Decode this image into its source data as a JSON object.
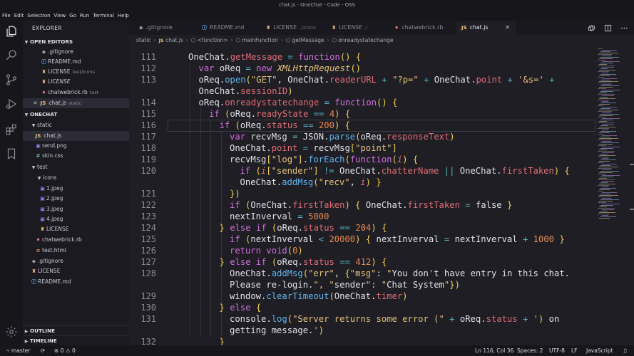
{
  "window": {
    "title": "chat.js - OneChat - Code - OSS"
  },
  "menu": [
    "File",
    "Edit",
    "Selection",
    "View",
    "Go",
    "Run",
    "Terminal",
    "Help"
  ],
  "activity": {
    "icons": [
      "files-icon",
      "search-icon",
      "source-control-icon",
      "run-debug-icon",
      "extensions-icon",
      "bookmark-icon",
      "gear-icon"
    ]
  },
  "sidebar": {
    "title": "EXPLORER",
    "open_editors": {
      "label": "OPEN EDITORS",
      "items": [
        {
          "name": ".gitignore",
          "desc": "",
          "icon": "git"
        },
        {
          "name": "README.md",
          "desc": "",
          "icon": "md"
        },
        {
          "name": "LICENSE",
          "desc": "test/icons",
          "icon": "lic"
        },
        {
          "name": "LICENSE",
          "desc": "",
          "icon": "lic",
          "italic": true
        },
        {
          "name": "chatwebrick.rb",
          "desc": "test",
          "icon": "rb"
        },
        {
          "name": "chat.js",
          "desc": "static",
          "icon": "js",
          "active": true
        }
      ]
    },
    "project": {
      "label": "ONECHAT",
      "items": [
        {
          "name": "static",
          "type": "folder",
          "depth": 1,
          "open": true
        },
        {
          "name": "chat.js",
          "icon": "js",
          "depth": 2,
          "selected": true
        },
        {
          "name": "send.png",
          "icon": "img",
          "depth": 2
        },
        {
          "name": "skin.css",
          "icon": "css",
          "depth": 2
        },
        {
          "name": "test",
          "type": "folder",
          "depth": 1,
          "open": true
        },
        {
          "name": "icons",
          "type": "folder",
          "depth": 2,
          "open": true
        },
        {
          "name": "1.jpeg",
          "icon": "img",
          "depth": 3
        },
        {
          "name": "2.jpeg",
          "icon": "img",
          "depth": 3
        },
        {
          "name": "3.jpeg",
          "icon": "img",
          "depth": 3
        },
        {
          "name": "4.jpeg",
          "icon": "img",
          "depth": 3
        },
        {
          "name": "LICENSE",
          "icon": "lic",
          "depth": 3
        },
        {
          "name": "chatwebrick.rb",
          "icon": "rb",
          "depth": 2
        },
        {
          "name": "test.html",
          "icon": "html",
          "depth": 2
        },
        {
          "name": ".gitignore",
          "icon": "git",
          "depth": 1
        },
        {
          "name": "LICENSE",
          "icon": "lic",
          "depth": 1
        },
        {
          "name": "README.md",
          "icon": "md",
          "depth": 1
        }
      ]
    },
    "outline": "OUTLINE",
    "timeline": "TIMELINE"
  },
  "tabs": [
    {
      "label": ".gitignore",
      "desc": "",
      "icon": "git"
    },
    {
      "label": "README.md",
      "desc": "",
      "icon": "md"
    },
    {
      "label": "LICENSE",
      "desc": "../icons",
      "icon": "lic"
    },
    {
      "label": "LICENSE",
      "desc": "./",
      "icon": "lic"
    },
    {
      "label": "chatwebrick.rb",
      "desc": "",
      "icon": "rb"
    },
    {
      "label": "chat.js",
      "desc": "",
      "icon": "js",
      "active": true
    }
  ],
  "breadcrumb": [
    "static",
    "chat.js",
    "<function>",
    "mainFunction",
    "getMessage",
    "onreadystatechange"
  ],
  "editor": {
    "lines": [
      {
        "n": "111",
        "t": "OneChat.getMessage = function() {"
      },
      {
        "n": "112",
        "t": "var oReq = new XMLHttpRequest()"
      },
      {
        "n": "113",
        "t": "oReq.open(\"GET\", OneChat.readerURL + \"?p=\" + OneChat.point + '&s=' +"
      },
      {
        "n": "",
        "t": "OneChat.sessionID)"
      },
      {
        "n": "114",
        "t": "oReq.onreadystatechange = function() {"
      },
      {
        "n": "115",
        "t": "if (oReq.readyState == 4) {"
      },
      {
        "n": "116",
        "t": "if (oReq.status == 200) {"
      },
      {
        "n": "117",
        "t": "var recvMsg = JSON.parse(oReq.responseText)"
      },
      {
        "n": "118",
        "t": "OneChat.point = recvMsg[\"point\"]"
      },
      {
        "n": "119",
        "t": "recvMsg[\"log\"].forEach(function(i) {"
      },
      {
        "n": "120",
        "t": "if (i[\"sender\"] != OneChat.chatterName || OneChat.firstTaken) {"
      },
      {
        "n": "",
        "t": "OneChat.addMsg(\"recv\", i) }"
      },
      {
        "n": "121",
        "t": "})"
      },
      {
        "n": "122",
        "t": "if (OneChat.firstTaken) { OneChat.firstTaken = false }"
      },
      {
        "n": "123",
        "t": "nextInverval = 5000"
      },
      {
        "n": "124",
        "t": "} else if (oReq.status == 204) {"
      },
      {
        "n": "125",
        "t": "if (nextInverval < 20000) { nextInverval = nextInverval + 1000 }"
      },
      {
        "n": "126",
        "t": "return void(0)"
      },
      {
        "n": "127",
        "t": "} else if (oReq.status == 412) {"
      },
      {
        "n": "128",
        "t": "OneChat.addMsg(\"err\", {\"msg\": \"You don't have entry in this chat."
      },
      {
        "n": "",
        "t": "Please re-login.\", \"sender\": \"Chat System\"})"
      },
      {
        "n": "129",
        "t": "window.clearTimeout(OneChat.timer)"
      },
      {
        "n": "130",
        "t": "} else {"
      },
      {
        "n": "131",
        "t": "console.log(\"Server returns some error (\" + oReq.status + ') on"
      },
      {
        "n": "",
        "t": "getting message.')"
      },
      {
        "n": "132",
        "t": "}"
      }
    ]
  },
  "status": {
    "branch": "master",
    "problems": "0",
    "warnings": "0",
    "position": "Ln 116, Col 36",
    "spaces": "Spaces: 2",
    "encoding": "UTF-8",
    "eol": "LF",
    "language": "JavaScript"
  },
  "colors": {
    "background": "#1e1e24",
    "keyword": "#d16fe0",
    "function": "#62b4ef",
    "string": "#e5c07b",
    "property": "#e06c75",
    "number": "#e8894f"
  }
}
